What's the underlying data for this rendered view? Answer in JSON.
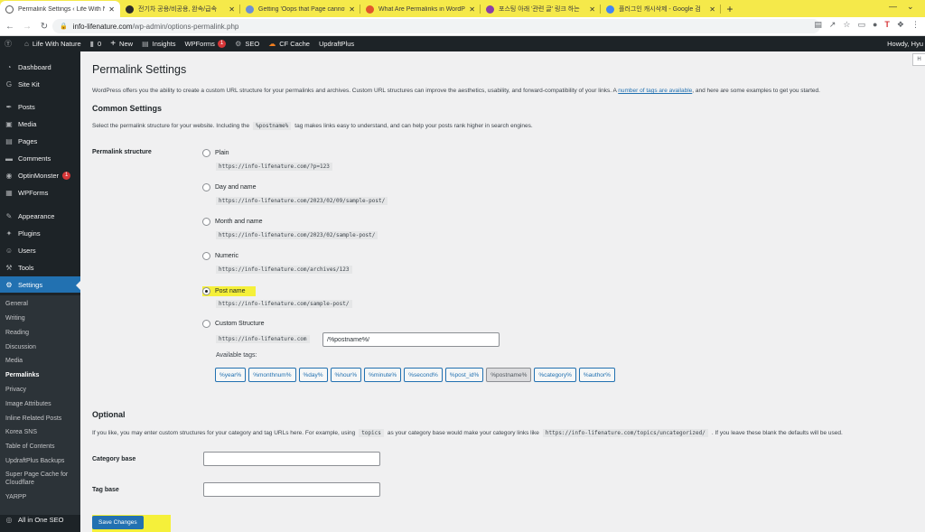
{
  "browser": {
    "tabs": [
      {
        "title": "Permalink Settings ‹ Life With N",
        "favicon_color": "#ffffff",
        "active": true
      },
      {
        "title": "전기차 공용/비공용, 완속/급속",
        "favicon_color": "#2b2b2b",
        "active": false
      },
      {
        "title": "Getting 'Oops that Page cannot",
        "favicon_color": "#6b8fd6",
        "active": false
      },
      {
        "title": "What Are Permalinks in WordP",
        "favicon_color": "#e2572c",
        "active": false
      },
      {
        "title": "포스팅 아래 '관련 글' 링크 하는",
        "favicon_color": "#8a3fa8",
        "active": false
      },
      {
        "title": "플러그인 캐시삭제 - Google 검",
        "favicon_color": "#4285f4",
        "active": false
      }
    ],
    "url_domain": "info-lifenature.com",
    "url_path": "/wp-admin/options-permalink.php"
  },
  "adminbar": {
    "site_name": "Life With Nature",
    "comments_count": "0",
    "new_label": "New",
    "insights_label": "Insights",
    "wpforms_label": "WPForms",
    "wpforms_badge": "1",
    "seo_label": "SEO",
    "cf_cache_label": "CF Cache",
    "updraft_label": "UpdraftPlus",
    "howdy": "Howdy, Hyu"
  },
  "sidebar": {
    "items": [
      {
        "label": "Dashboard",
        "icon": "dashboard-icon",
        "glyph": "◔"
      },
      {
        "label": "Site Kit",
        "icon": "sitekit-icon",
        "glyph": "G"
      },
      {
        "label": "Posts",
        "icon": "pin-icon",
        "glyph": "✒"
      },
      {
        "label": "Media",
        "icon": "media-icon",
        "glyph": "▣"
      },
      {
        "label": "Pages",
        "icon": "pages-icon",
        "glyph": "▤"
      },
      {
        "label": "Comments",
        "icon": "comments-icon",
        "glyph": "▬"
      },
      {
        "label": "OptinMonster",
        "icon": "optinmonster-icon",
        "glyph": "◉",
        "badge": "1"
      },
      {
        "label": "WPForms",
        "icon": "wpforms-icon",
        "glyph": "▦"
      },
      {
        "label": "Appearance",
        "icon": "brush-icon",
        "glyph": "✎"
      },
      {
        "label": "Plugins",
        "icon": "plugin-icon",
        "glyph": "✦"
      },
      {
        "label": "Users",
        "icon": "users-icon",
        "glyph": "☺"
      },
      {
        "label": "Tools",
        "icon": "tools-icon",
        "glyph": "⚒"
      },
      {
        "label": "Settings",
        "icon": "settings-icon",
        "glyph": "⚙"
      }
    ],
    "submenu": [
      "General",
      "Writing",
      "Reading",
      "Discussion",
      "Media",
      "Permalinks",
      "Privacy",
      "Image Attributes",
      "Inline Related Posts",
      "Korea SNS",
      "Table of Contents",
      "UpdraftPlus Backups",
      "Super Page Cache for Cloudflare",
      "YARPP"
    ],
    "bottom_item": {
      "label": "All in One SEO",
      "icon": "aioseo-icon",
      "glyph": "◎"
    }
  },
  "main": {
    "help_label": "H",
    "page_title": "Permalink Settings",
    "intro_text": "WordPress offers you the ability to create a custom URL structure for your permalinks and archives. Custom URL structures can improve the aesthetics, usability, and forward-compatibility of your links. A",
    "intro_link": "number of tags are available",
    "intro_tail": ", and here are some examples to get you started.",
    "common_heading": "Common Settings",
    "common_desc_before": "Select the permalink structure for your website. Including the",
    "common_desc_code": "%postname%",
    "common_desc_after": "tag makes links easy to understand, and can help your posts rank higher in search engines.",
    "structure_label": "Permalink structure",
    "options": [
      {
        "label": "Plain",
        "sample": "https://info-lifenature.com/?p=123",
        "checked": false
      },
      {
        "label": "Day and name",
        "sample": "https://info-lifenature.com/2023/02/09/sample-post/",
        "checked": false
      },
      {
        "label": "Month and name",
        "sample": "https://info-lifenature.com/2023/02/sample-post/",
        "checked": false
      },
      {
        "label": "Numeric",
        "sample": "https://info-lifenature.com/archives/123",
        "checked": false
      },
      {
        "label": "Post name",
        "sample": "https://info-lifenature.com/sample-post/",
        "checked": true
      },
      {
        "label": "Custom Structure",
        "sample": "https://info-lifenature.com",
        "checked": false
      }
    ],
    "custom_value": "/%postname%/",
    "available_tags_label": "Available tags:",
    "tags": [
      "%year%",
      "%monthnum%",
      "%day%",
      "%hour%",
      "%minute%",
      "%second%",
      "%post_id%",
      "%postname%",
      "%category%",
      "%author%"
    ],
    "active_tag": "%postname%",
    "optional_heading": "Optional",
    "optional_desc_before": "If you like, you may enter custom structures for your category and tag URLs here. For example, using",
    "optional_desc_code1": "topics",
    "optional_desc_mid": "as your category base would make your category links like",
    "optional_desc_code2": "https://info-lifenature.com/topics/uncategorized/",
    "optional_desc_after": ". If you leave these blank the defaults will be used.",
    "category_base_label": "Category base",
    "category_base_value": "",
    "tag_base_label": "Tag base",
    "tag_base_value": "",
    "save_label": "Save Changes"
  },
  "colors": {
    "admin_dark": "#1d2327",
    "accent": "#2271b1",
    "highlight": "#f5f03a",
    "badge": "#d63638"
  }
}
